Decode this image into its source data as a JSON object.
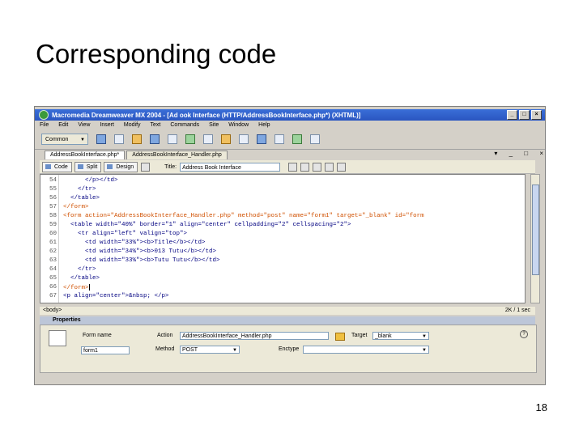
{
  "slide": {
    "title": "Corresponding code",
    "page_number": "18"
  },
  "window": {
    "title": "Macromedia Dreamweaver MX 2004 - [Ad         ook Interface (HTTP/AddressBookInterface.php*) (XHTML)]",
    "app_icon": "dreamweaver-icon",
    "buttons": [
      "_",
      "□",
      "×"
    ]
  },
  "menu": [
    "File",
    "Edit",
    "View",
    "Insert",
    "Modify",
    "Text",
    "Commands",
    "Site",
    "Window",
    "Help"
  ],
  "insert_bar": {
    "category": "Common"
  },
  "tabs": [
    {
      "label": "AddressBookInterface.php*"
    },
    {
      "label": "AddressBookInterface_Handler.php"
    }
  ],
  "tab_controls": "▾ _ □ ×",
  "doc_toolbar": {
    "code_label": "Code",
    "split_label": "Split",
    "design_label": "Design",
    "title_label": "Title:",
    "title_value": "Address Book Interface"
  },
  "code": {
    "line_numbers": [
      "54",
      "55",
      "56",
      "57",
      "58",
      "59",
      "60",
      "61",
      "62",
      "63",
      "64",
      "65",
      "66",
      "67"
    ],
    "lines": [
      "      </p></td>",
      "    </tr>",
      "  </table>",
      "</form>",
      "<form action=\"AddressBookInterface_Handler.php\" method=\"post\" name=\"form1\" target=\"_blank\" id=\"form",
      "  <table width=\"40%\" border=\"1\" align=\"center\" cellpadding=\"2\" cellspacing=\"2\">",
      "    <tr align=\"left\" valign=\"top\">",
      "      <td width=\"33%\"><b>Title</b></td>",
      "      <td width=\"34%\"><b>013 Tutu</b></td>",
      "      <td width=\"33%\"><b>Tutu Tutu</b></td>",
      "    </tr>",
      "  </table>",
      "</form>",
      "<p align=\"center\">&nbsp; </p>"
    ]
  },
  "status_bar": {
    "tag": "<body>",
    "size": "2K / 1 sec"
  },
  "properties": {
    "header": "Properties",
    "form_name_label": "Form name",
    "form_name_value": "form1",
    "action_label": "Action",
    "action_value": "AddressBookInterface_Handler.php",
    "target_label": "Target",
    "target_value": "_blank",
    "method_label": "Method",
    "method_value": "POST",
    "enctype_label": "Enctype"
  }
}
